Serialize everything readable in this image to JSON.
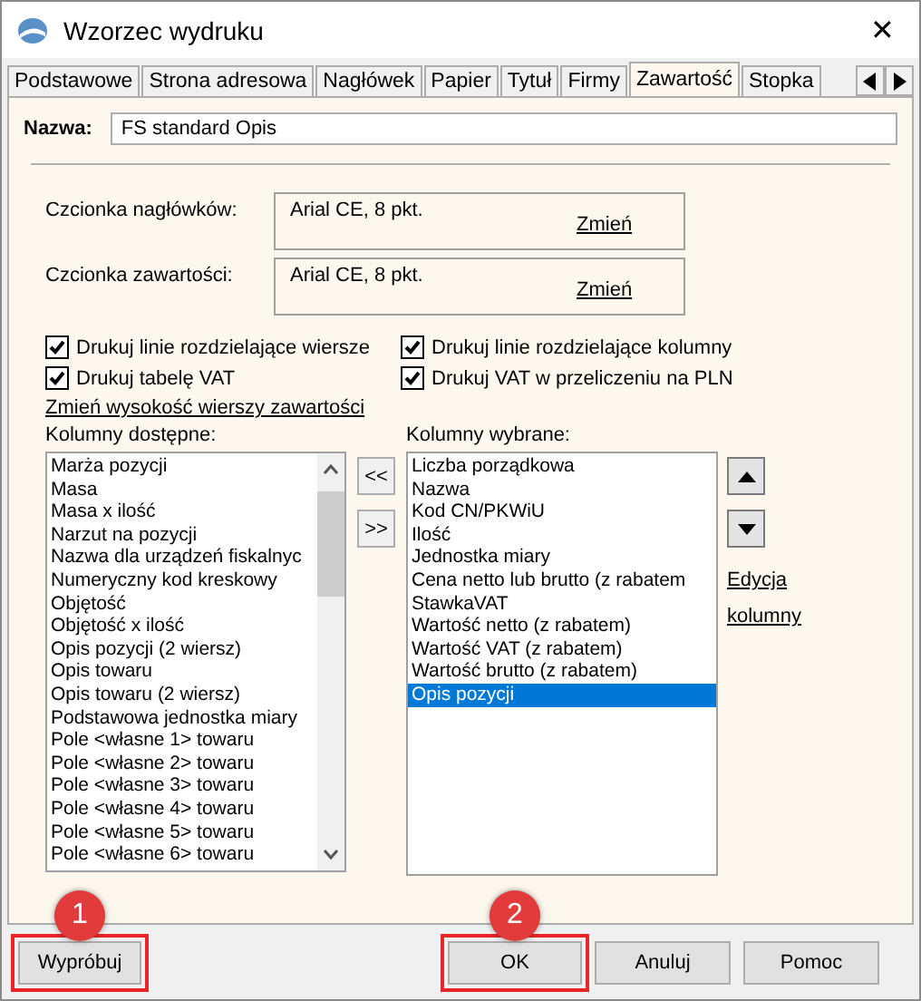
{
  "window": {
    "title": "Wzorzec wydruku",
    "close": "✕"
  },
  "tabs": [
    {
      "label": "Podstawowe",
      "selected": false
    },
    {
      "label": "Strona adresowa",
      "selected": false
    },
    {
      "label": "Nagłówek",
      "selected": false
    },
    {
      "label": "Papier",
      "selected": false
    },
    {
      "label": "Tytuł",
      "selected": false
    },
    {
      "label": "Firmy",
      "selected": false
    },
    {
      "label": "Zawartość",
      "selected": true
    },
    {
      "label": "Stopka",
      "selected": false
    }
  ],
  "name_field": {
    "label": "Nazwa:",
    "value": "FS standard Opis"
  },
  "fonts": [
    {
      "label": "Czcionka nagłówków:",
      "value": "Arial CE, 8 pkt.",
      "link": "Zmień"
    },
    {
      "label": "Czcionka zawartości:",
      "value": "Arial CE, 8 pkt.",
      "link": "Zmień"
    }
  ],
  "options": [
    {
      "label": "Drukuj linie rozdzielające wiersze",
      "checked": true
    },
    {
      "label": "Drukuj linie rozdzielające kolumny",
      "checked": true
    },
    {
      "label": "Drukuj tabelę VAT",
      "checked": true
    },
    {
      "label": "Drukuj VAT w przeliczeniu na PLN",
      "checked": true
    }
  ],
  "row_height_link": "Zmień wysokość wierszy zawartości",
  "available": {
    "label": "Kolumny dostępne:",
    "items": [
      {
        "text": "Marża pozycji",
        "selected": false
      },
      {
        "text": "Masa",
        "selected": false
      },
      {
        "text": "Masa x ilość",
        "selected": false
      },
      {
        "text": "Narzut na pozycji",
        "selected": false
      },
      {
        "text": "Nazwa dla urządzeń fiskalnyc",
        "selected": false
      },
      {
        "text": "Numeryczny kod kreskowy",
        "selected": false
      },
      {
        "text": "Objętość",
        "selected": false
      },
      {
        "text": "Objętość x ilość",
        "selected": false
      },
      {
        "text": "Opis pozycji (2 wiersz)",
        "selected": false
      },
      {
        "text": "Opis towaru",
        "selected": false
      },
      {
        "text": "Opis towaru (2 wiersz)",
        "selected": false
      },
      {
        "text": "Podstawowa jednostka miary",
        "selected": false
      },
      {
        "text": "Pole <własne 1> towaru",
        "selected": false
      },
      {
        "text": "Pole <własne 2> towaru",
        "selected": false
      },
      {
        "text": "Pole <własne 3> towaru",
        "selected": false
      },
      {
        "text": "Pole <własne 4> towaru",
        "selected": false
      },
      {
        "text": "Pole <własne 5> towaru",
        "selected": false
      },
      {
        "text": "Pole <własne 6> towaru",
        "selected": false
      }
    ]
  },
  "move_buttons": [
    "<<",
    ">>"
  ],
  "chosen": {
    "label": "Kolumny wybrane:",
    "items": [
      {
        "text": "Liczba porządkowa",
        "selected": false
      },
      {
        "text": "Nazwa",
        "selected": false
      },
      {
        "text": "Kod CN/PKWiU",
        "selected": false
      },
      {
        "text": "Ilość",
        "selected": false
      },
      {
        "text": "Jednostka miary",
        "selected": false
      },
      {
        "text": "Cena netto lub brutto (z rabatem",
        "selected": false
      },
      {
        "text": "StawkaVAT",
        "selected": false
      },
      {
        "text": "Wartość netto (z rabatem)",
        "selected": false
      },
      {
        "text": "Wartość VAT (z rabatem)",
        "selected": false
      },
      {
        "text": "Wartość brutto (z rabatem)",
        "selected": false
      },
      {
        "text": "Opis pozycji",
        "selected": true
      }
    ]
  },
  "edit_columns_link": "Edycja kolumny",
  "buttons": [
    {
      "label": "Wypróbuj",
      "annotation": "1"
    },
    {
      "label": "OK",
      "annotation": "2"
    },
    {
      "label": "Anuluj"
    },
    {
      "label": "Pomoc"
    }
  ]
}
